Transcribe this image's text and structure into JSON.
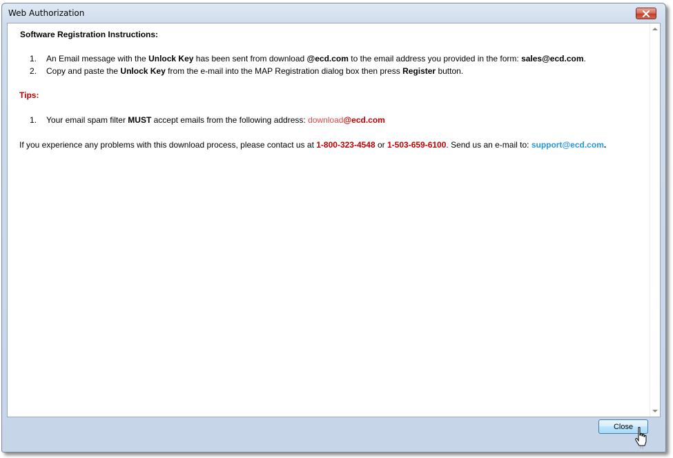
{
  "window": {
    "title": "Web Authorization"
  },
  "content": {
    "heading": "Software Registration Instructions:",
    "instructions": [
      {
        "number": "1.",
        "t1": "An Email message with the ",
        "b1": "Unlock Key",
        "t2": " has been sent from download ",
        "b2": "@ecd.com",
        "t3": " to the email address you provided in the form: ",
        "b3": "sales@ecd.com",
        "t4": "."
      },
      {
        "number": "2.",
        "t1": "Copy and paste the ",
        "b1": "Unlock Key",
        "t2": " from the e-mail into the MAP Registration dialog box then press ",
        "b2": "Register",
        "t3": " button."
      }
    ],
    "tips_label": "Tips:",
    "tips": [
      {
        "number": "1.",
        "t1": "Your email spam filter ",
        "b1": "MUST",
        "t2": " accept emails from the following address:  ",
        "addr_user": "download",
        "addr_domain": "@ecd.com"
      }
    ],
    "contact": {
      "t1": "If you experience any problems with this download process, please contact us at ",
      "phone1": "1-800-323-4548",
      "t2": " or ",
      "phone2": "1-503-659-6100",
      "t3": ". Send us an e-mail to: ",
      "email": "support@ecd.com",
      "t4": "."
    }
  },
  "footer": {
    "close_label": "Close"
  },
  "colors": {
    "highlight_red": "#c00000",
    "link_blue": "#2a97d6"
  }
}
